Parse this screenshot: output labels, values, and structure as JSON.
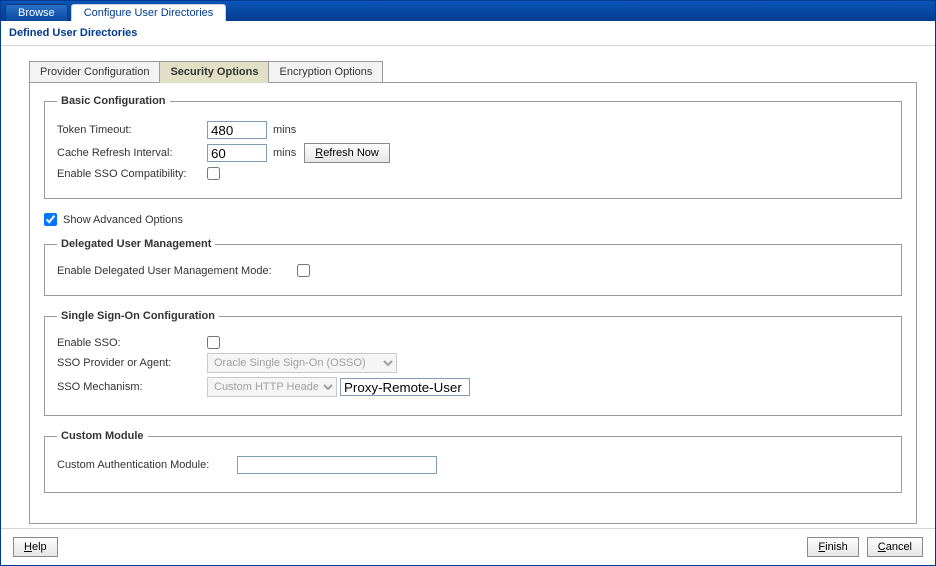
{
  "top_tabs": {
    "browse": "Browse",
    "configure": "Configure User Directories"
  },
  "page_title": "Defined User Directories",
  "inner_tabs": {
    "provider": "Provider Configuration",
    "security": "Security Options",
    "encryption": "Encryption Options"
  },
  "basic": {
    "legend": "Basic Configuration",
    "token_timeout_label": "Token Timeout:",
    "token_timeout_value": "480",
    "cache_label": "Cache Refresh Interval:",
    "cache_value": "60",
    "mins": "mins",
    "refresh_btn": "Refresh Now",
    "enable_sso_compat_label": "Enable SSO Compatibility:"
  },
  "advanced_toggle": "Show Advanced Options",
  "delegated": {
    "legend": "Delegated User Management",
    "enable_label": "Enable Delegated User Management Mode:"
  },
  "sso": {
    "legend": "Single Sign-On Configuration",
    "enable_label": "Enable SSO:",
    "provider_label": "SSO Provider or Agent:",
    "provider_value": "Oracle Single Sign-On (OSSO)",
    "mechanism_label": "SSO Mechanism:",
    "mechanism_select": "Custom HTTP Header",
    "mechanism_value": "Proxy-Remote-User"
  },
  "custom": {
    "legend": "Custom Module",
    "auth_label": "Custom Authentication Module:",
    "auth_value": ""
  },
  "footer": {
    "help": "Help",
    "finish": "Finish",
    "cancel": "Cancel"
  },
  "underline": {
    "h": "H",
    "r": "R",
    "f": "F",
    "c": "C"
  }
}
